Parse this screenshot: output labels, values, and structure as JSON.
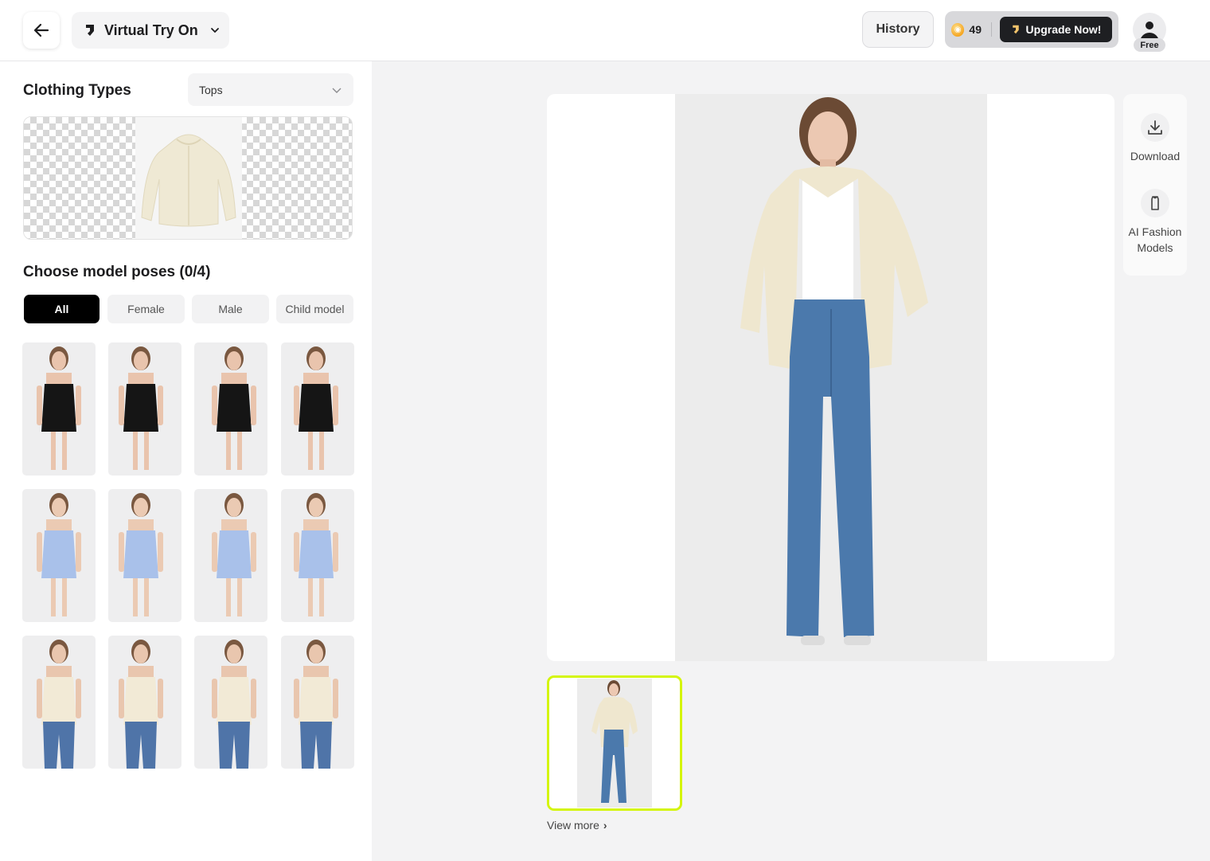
{
  "header": {
    "back_icon": "arrow-left-icon",
    "tool_name": "Virtual Try On",
    "tool_icon": "app-logo-icon",
    "history_label": "History",
    "credits": "49",
    "upgrade_label": "Upgrade Now!",
    "plan_badge": "Free"
  },
  "clothing": {
    "title": "Clothing Types",
    "selected_type": "Tops"
  },
  "poses": {
    "title": "Choose model poses (0/4)",
    "filters": [
      {
        "label": "All",
        "active": true
      },
      {
        "label": "Female",
        "active": false
      },
      {
        "label": "Male",
        "active": false
      },
      {
        "label": "Child model",
        "active": false
      }
    ],
    "rows": [
      {
        "top": "#151515",
        "bottom": "#151515",
        "skin": "#e9c4ad"
      },
      {
        "top": "#a9c1ea",
        "bottom": "#a9c1ea",
        "skin": "#ebcab3"
      },
      {
        "top": "#f2ead6",
        "bottom": "#4f74a8",
        "skin": "#e9c6ae"
      }
    ]
  },
  "tools": {
    "download_label": "Download",
    "fashion_label": "AI Fashion Models"
  },
  "results": {
    "view_more_label": "View more",
    "accent_color": "#d4f50c"
  }
}
